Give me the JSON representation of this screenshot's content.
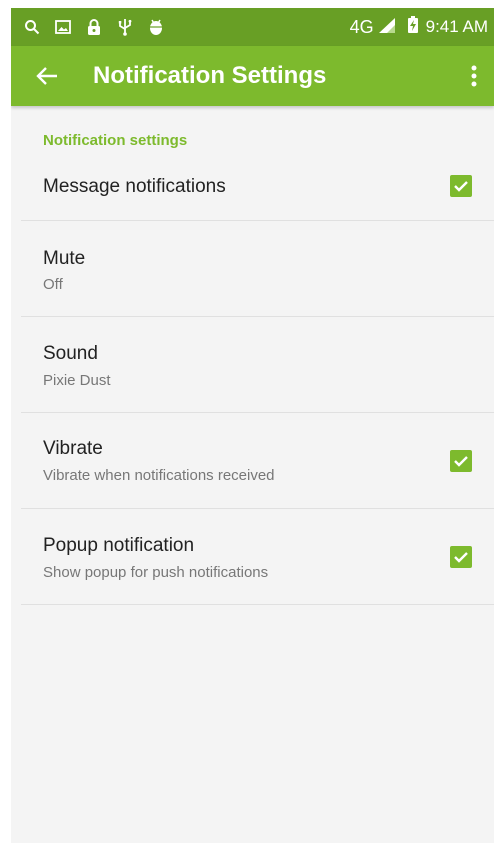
{
  "status_bar": {
    "network": "4G",
    "time": "9:41 AM",
    "icons": [
      "search-icon",
      "gallery-icon",
      "lock-icon",
      "usb-icon",
      "android-debug-icon",
      "signal-icon",
      "battery-charging-icon"
    ]
  },
  "app_bar": {
    "title": "Notification Settings",
    "back_icon": "arrow-back-icon",
    "menu_icon": "more-vert-icon"
  },
  "section": {
    "header": "Notification settings"
  },
  "preferences": [
    {
      "title": "Message notifications",
      "summary": "",
      "checked": true
    },
    {
      "title": "Mute",
      "summary": "Off"
    },
    {
      "title": "Sound",
      "summary": "Pixie Dust"
    },
    {
      "title": "Vibrate",
      "summary": "Vibrate when notifications received",
      "checked": true
    },
    {
      "title": "Popup notification",
      "summary": "Show popup for push notifications",
      "checked": true
    }
  ],
  "colors": {
    "accent": "#7dba2d",
    "status_bar": "#689f25",
    "background": "#f4f4f4"
  }
}
